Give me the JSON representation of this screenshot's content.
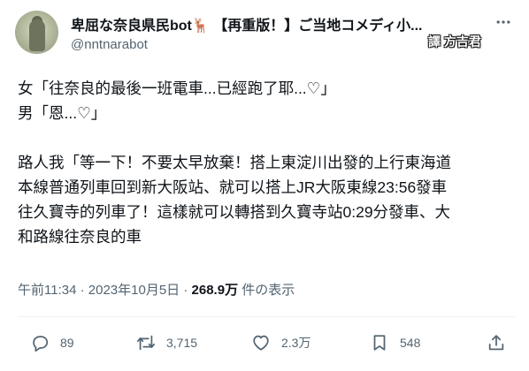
{
  "tweet": {
    "display_name": "卑屈な奈良県民bot",
    "display_name_emoji": "🦌",
    "display_name_suffix": "【再重版！】ご当地コメディ小...",
    "handle": "@nntnarabot",
    "watermark": "譯 方吉君",
    "body_lines": [
      "女「往奈良的最後一班電車...已經跑了耶...♡」",
      "男「恩...♡」",
      "",
      "路人我「等一下！不要太早放棄！搭上東淀川出發的上行東海道",
      "本線普通列車回到新大阪站、就可以搭上JR大阪東線23:56發車",
      "往久寶寺的列車了！這樣就可以轉搭到久寶寺站0:29分發車、大",
      "和路線往奈良的車"
    ],
    "time": "午前11:34",
    "separator": "·",
    "date": "2023年10月5日",
    "views_count": "268.9万",
    "views_label": "件の表示"
  },
  "actions": {
    "reply_count": "89",
    "retweet_count": "3,715",
    "like_count": "2.3万",
    "bookmark_count": "548",
    "reply_icon": "reply-icon",
    "retweet_icon": "retweet-icon",
    "like_icon": "heart-icon",
    "bookmark_icon": "bookmark-icon",
    "share_icon": "share-icon"
  },
  "colors": {
    "text": "#0f1419",
    "secondary": "#536471",
    "divider": "#eff3f4"
  }
}
